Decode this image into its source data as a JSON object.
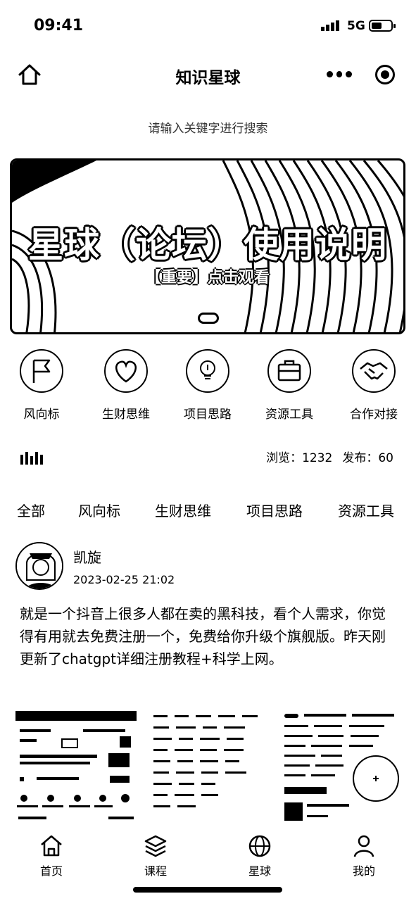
{
  "status_bar": {
    "time": "09:41",
    "network": "5G"
  },
  "nav": {
    "title": "知识星球"
  },
  "search": {
    "placeholder": "请输入关键字进行搜索"
  },
  "banner": {
    "title": "星球（论坛）使用说明",
    "subtitle": "【重要】点击观看"
  },
  "categories": [
    {
      "label": "风向标",
      "icon": "flag-icon"
    },
    {
      "label": "生财思维",
      "icon": "heart-icon"
    },
    {
      "label": "项目思路",
      "icon": "lightbulb-icon"
    },
    {
      "label": "资源工具",
      "icon": "briefcase-icon"
    },
    {
      "label": "合作对接",
      "icon": "handshake-icon"
    }
  ],
  "stats": {
    "views": "浏览：1232",
    "posts": "发布：60"
  },
  "filter_tabs": [
    "全部",
    "风向标",
    "生财思维",
    "项目思路",
    "资源工具"
  ],
  "post": {
    "author": "凯旋",
    "time": "2023-02-25 21:02",
    "body": "就是一个抖音上很多人都在卖的黑科技，看个人需求，你觉得有用就去免费注册一个，免费给你升级个旗舰版。昨天刚更新了chatgpt详细注册教程+科学上网。"
  },
  "tab_bar": [
    {
      "label": "首页",
      "icon": "home-icon"
    },
    {
      "label": "课程",
      "icon": "layers-icon"
    },
    {
      "label": "星球",
      "icon": "globe-icon"
    },
    {
      "label": "我的",
      "icon": "user-icon"
    }
  ]
}
